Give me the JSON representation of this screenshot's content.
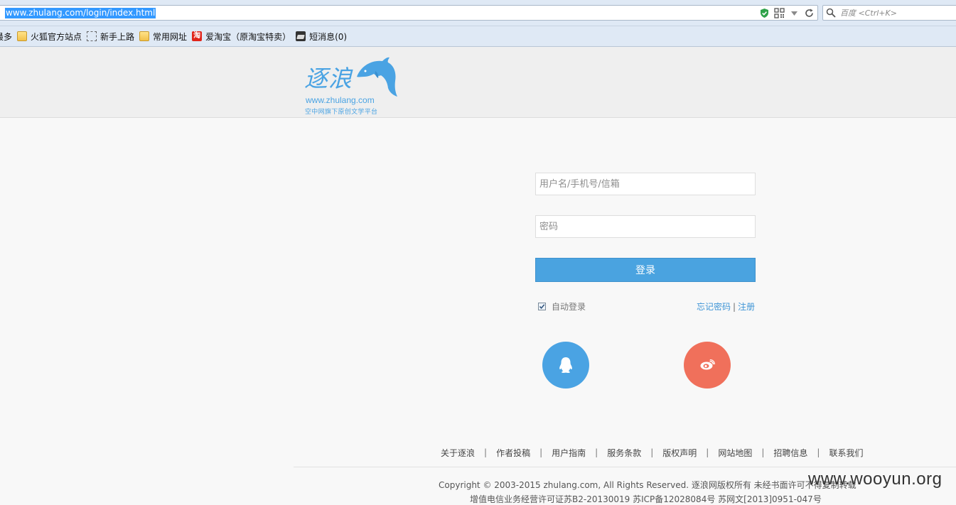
{
  "browser": {
    "url": "www.zhulang.com/login/index.html",
    "search_placeholder": "百度 <Ctrl+K>",
    "bookmarks": [
      {
        "label": "最多",
        "icon": "none"
      },
      {
        "label": "火狐官方站点",
        "icon": "folder-icon"
      },
      {
        "label": "新手上路",
        "icon": "dashed-box-icon"
      },
      {
        "label": "常用网址",
        "icon": "folder-icon"
      },
      {
        "label": "爱淘宝（原淘宝特卖）",
        "icon": "taobao-icon"
      },
      {
        "label": "短消息(0)",
        "icon": "message-icon"
      }
    ]
  },
  "header": {
    "logo_text": "逐浪",
    "logo_url": "www.zhulang.com",
    "logo_slogan": "空中网旗下原创文学平台"
  },
  "login": {
    "username_placeholder": "用户名/手机号/信箱",
    "password_placeholder": "密码",
    "submit_label": "登录",
    "auto_login_label": "自动登录",
    "auto_login_checked": true,
    "forgot_label": "忘记密码",
    "separator": "|",
    "register_label": "注册",
    "social": [
      {
        "name": "qq",
        "icon": "qq-penguin-icon",
        "color": "#4aa3e3"
      },
      {
        "name": "weibo",
        "icon": "weibo-eye-icon",
        "color": "#f0705b"
      }
    ]
  },
  "footer": {
    "links": [
      "关于逐浪",
      "作者投稿",
      "用户指南",
      "服务条款",
      "版权声明",
      "网站地图",
      "招聘信息",
      "联系我们"
    ],
    "link_separator": "|",
    "copyright": "Copyright © 2003-2015 zhulang.com, All Rights Reserved. 逐浪网版权所有 未经书面许可不得复制转载",
    "license": "增值电信业务经营许可证苏B2-20130019    苏ICP备12028084号    苏网文[2013]0951-047号"
  },
  "watermark": "www.wooyun.org",
  "colors": {
    "brand_blue": "#4aa3e0",
    "weibo_red": "#f0705b",
    "link_blue": "#3f95d6",
    "header_bg": "#efefef",
    "page_bg": "#f8f8f8"
  }
}
